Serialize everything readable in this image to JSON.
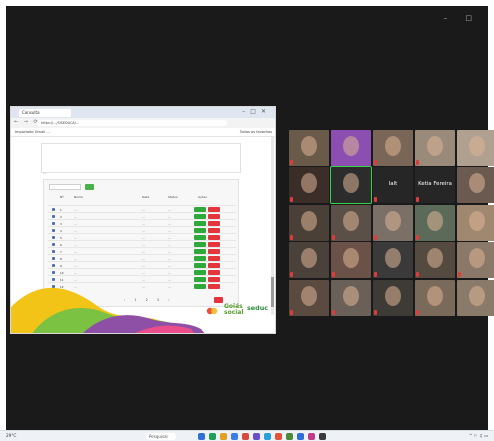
{
  "window_controls": "– □",
  "shared_screen": {
    "tab_title": "Consulta",
    "url": "https://.../SISEDUCA/...",
    "nav_glyphs": "← → ⟳",
    "bookmarks_text": "Importado   Gmail   ...",
    "bookmarks_right": "Todos os favoritos",
    "page_tabs": "...",
    "filter_placeholder": "...",
    "table_headers": [
      "Nº",
      "Nome",
      "Data",
      "Status",
      "Ações"
    ],
    "rows": [
      {
        "name": "...",
        "date": "...",
        "status": "..."
      },
      {
        "name": "...",
        "date": "...",
        "status": "..."
      },
      {
        "name": "...",
        "date": "...",
        "status": "..."
      },
      {
        "name": "...",
        "date": "...",
        "status": "..."
      },
      {
        "name": "...",
        "date": "...",
        "status": "..."
      },
      {
        "name": "...",
        "date": "...",
        "status": "..."
      },
      {
        "name": "...",
        "date": "...",
        "status": "..."
      },
      {
        "name": "...",
        "date": "...",
        "status": "..."
      },
      {
        "name": "...",
        "date": "...",
        "status": "..."
      },
      {
        "name": "...",
        "date": "...",
        "status": "..."
      },
      {
        "name": "...",
        "date": "...",
        "status": "..."
      },
      {
        "name": "...",
        "date": "...",
        "status": "..."
      }
    ],
    "pager": "‹ 1 2 3 ›",
    "logo_cvc": "CVC",
    "logo_goias_line1": "Goiás",
    "logo_goias_line2": "social",
    "logo_seduc": "seduc"
  },
  "gallery": {
    "tiles": [
      {
        "label": "",
        "big": "",
        "color": "#6a5a4a",
        "mic": true
      },
      {
        "label": "",
        "big": "",
        "color": "#8a4fb0",
        "mic": false
      },
      {
        "label": "",
        "big": "",
        "color": "#7a6656",
        "mic": true
      },
      {
        "label": "",
        "big": "",
        "color": "#9a8a7a",
        "mic": true
      },
      {
        "label": "",
        "big": "",
        "color": "#b0a090",
        "mic": false
      },
      {
        "label": "",
        "big": "",
        "color": "#3b2e28",
        "mic": true
      },
      {
        "label": "",
        "big": "",
        "color": "#2c2c2c",
        "mic": false
      },
      {
        "label": "",
        "big": "lalt",
        "color": "#262626",
        "mic": true
      },
      {
        "label": "",
        "big": "Ketia Fereira",
        "color": "#262626",
        "mic": true
      },
      {
        "label": "",
        "big": "",
        "color": "#6a5a50",
        "mic": false
      },
      {
        "label": "",
        "big": "",
        "color": "#4a4038",
        "mic": true
      },
      {
        "label": "",
        "big": "",
        "color": "#5a5048",
        "mic": true
      },
      {
        "label": "",
        "big": "",
        "color": "#7a7068",
        "mic": true
      },
      {
        "label": "",
        "big": "",
        "color": "#5c6a5a",
        "mic": true
      },
      {
        "label": "",
        "big": "",
        "color": "#a08870",
        "mic": false
      },
      {
        "label": "",
        "big": "",
        "color": "#4a423a",
        "mic": true
      },
      {
        "label": "",
        "big": "",
        "color": "#6a5248",
        "mic": true
      },
      {
        "label": "",
        "big": "",
        "color": "#3a3a3a",
        "mic": true
      },
      {
        "label": "",
        "big": "",
        "color": "#544a40",
        "mic": true
      },
      {
        "label": "",
        "big": "",
        "color": "#8a7868",
        "mic": true
      },
      {
        "label": "",
        "big": "",
        "color": "#5a4a40",
        "mic": true
      },
      {
        "label": "",
        "big": "",
        "color": "#6a6058",
        "mic": true
      },
      {
        "label": "",
        "big": "",
        "color": "#3e3a36",
        "mic": true
      },
      {
        "label": "",
        "big": "",
        "color": "#7a6a5a",
        "mic": true
      },
      {
        "label": "",
        "big": "",
        "color": "#8a7a6a",
        "mic": false
      }
    ]
  },
  "taskbar": {
    "weather": "29°C",
    "search": "Pesquisar",
    "tray": "^ ⚐ ♫ ▭"
  }
}
